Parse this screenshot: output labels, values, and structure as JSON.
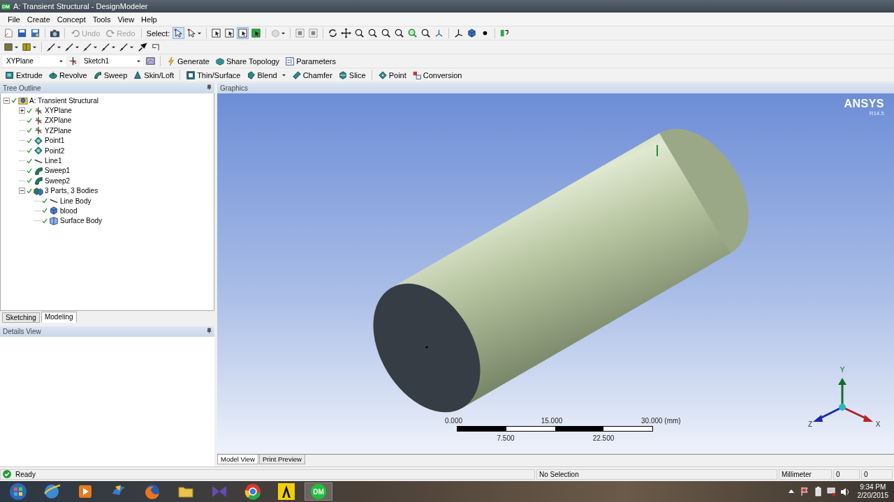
{
  "window": {
    "title": "A: Transient Structural - DesignModeler",
    "app_badge": "DM"
  },
  "menu": [
    "File",
    "Create",
    "Concept",
    "Tools",
    "View",
    "Help"
  ],
  "toolbar": {
    "undo": {
      "label": "Undo",
      "disabled": true
    },
    "redo": {
      "label": "Redo",
      "disabled": true
    },
    "select_label": "Select:"
  },
  "sketch_bar": {
    "plane": "XYPlane",
    "sketch": "Sketch1",
    "buttons": [
      {
        "label": "Generate",
        "kind": "generate"
      },
      {
        "label": "Share Topology",
        "kind": "share"
      },
      {
        "label": "Parameters",
        "kind": "parameters"
      }
    ]
  },
  "feature_bar": {
    "buttons": [
      {
        "label": "Extrude",
        "kind": "extrude",
        "dropdown": false
      },
      {
        "label": "Revolve",
        "kind": "revolve",
        "dropdown": false
      },
      {
        "label": "Sweep",
        "kind": "sweep",
        "dropdown": false
      },
      {
        "label": "Skin/Loft",
        "kind": "skin",
        "dropdown": false
      },
      {
        "label": "Thin/Surface",
        "kind": "thin",
        "dropdown": false
      },
      {
        "label": "Blend",
        "kind": "blend",
        "dropdown": true
      },
      {
        "label": "Chamfer",
        "kind": "chamfer",
        "dropdown": false
      },
      {
        "label": "Slice",
        "kind": "slice",
        "dropdown": false
      },
      {
        "label": "Point",
        "kind": "point",
        "dropdown": false
      },
      {
        "label": "Conversion",
        "kind": "conversion",
        "dropdown": false
      }
    ]
  },
  "tree_outline": {
    "title": "Tree Outline",
    "nodes": [
      {
        "label": "A: Transient Structural",
        "kind": "model",
        "expanded": true,
        "children": [
          {
            "label": "XYPlane",
            "kind": "plane",
            "expanded": false
          },
          {
            "label": "ZXPlane",
            "kind": "plane"
          },
          {
            "label": "YZPlane",
            "kind": "plane"
          },
          {
            "label": "Point1",
            "kind": "point"
          },
          {
            "label": "Point2",
            "kind": "point"
          },
          {
            "label": "Line1",
            "kind": "line"
          },
          {
            "label": "Sweep1",
            "kind": "sweep"
          },
          {
            "label": "Sweep2",
            "kind": "sweep"
          },
          {
            "label": "3 Parts, 3 Bodies",
            "kind": "parts",
            "expanded": true,
            "children": [
              {
                "label": "Line Body",
                "kind": "line"
              },
              {
                "label": "blood",
                "kind": "solid"
              },
              {
                "label": "Surface Body",
                "kind": "surface"
              }
            ]
          }
        ]
      }
    ]
  },
  "left_tabs": [
    {
      "label": "Sketching",
      "selected": false
    },
    {
      "label": "Modeling",
      "selected": true
    }
  ],
  "details_view": {
    "title": "Details View"
  },
  "graphics": {
    "title": "Graphics",
    "logo": "ANSYS",
    "version": "R14.5",
    "scale_bar": {
      "top_labels": [
        "0.000",
        "15.000",
        "30.000 (mm)"
      ],
      "bottom_labels": [
        "7.500",
        "22.500"
      ]
    },
    "triad": {
      "y": "Y",
      "z": "Z",
      "x": "X"
    },
    "tabs": [
      {
        "label": "Model View",
        "selected": true
      },
      {
        "label": "Print Preview",
        "selected": false
      }
    ]
  },
  "status_bar": {
    "message": "Ready",
    "selection": "No Selection",
    "units": "Millimeter",
    "field_1": "0",
    "field_2": "0"
  },
  "taskbar": {
    "dm_label": "DM",
    "time": "9:34 PM",
    "date": "2/20/2015"
  }
}
